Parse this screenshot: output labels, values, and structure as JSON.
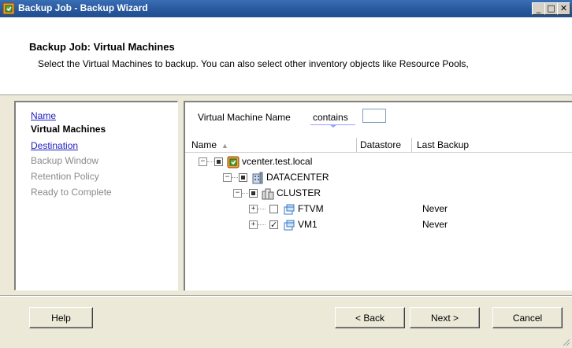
{
  "window": {
    "title": "Backup Job - Backup Wizard",
    "controls": {
      "minimize": "_",
      "maximize": "□",
      "close": "✕"
    }
  },
  "header": {
    "title": "Backup Job: Virtual Machines",
    "description": "Select the Virtual Machines to backup. You can also select other inventory objects like Resource Pools,"
  },
  "steps": [
    {
      "label": "Name",
      "state": "link"
    },
    {
      "label": "Virtual Machines",
      "state": "current"
    },
    {
      "label": "Destination",
      "state": "link"
    },
    {
      "label": "Backup Window",
      "state": "disabled"
    },
    {
      "label": "Retention Policy",
      "state": "disabled"
    },
    {
      "label": "Ready to Complete",
      "state": "disabled"
    }
  ],
  "filter": {
    "label": "Virtual Machine Name",
    "operator": "contains",
    "value": ""
  },
  "columns": {
    "name": "Name",
    "sort_indicator": "▲",
    "datastore": "Datastore",
    "last_backup": "Last Backup"
  },
  "tree": [
    {
      "label": "vcenter.test.local",
      "icon": "vcenter-icon",
      "check": "partial",
      "expander": "−",
      "last_backup": ""
    },
    {
      "label": "DATACENTER",
      "icon": "datacenter-icon",
      "check": "partial",
      "expander": "−",
      "last_backup": ""
    },
    {
      "label": "CLUSTER",
      "icon": "cluster-icon",
      "check": "partial",
      "expander": "−",
      "last_backup": ""
    },
    {
      "label": "FTVM",
      "icon": "vm-icon",
      "check": "unchecked",
      "expander": "+",
      "last_backup": "Never"
    },
    {
      "label": "VM1",
      "icon": "vm-icon",
      "check": "checked",
      "expander": "+",
      "last_backup": "Never"
    }
  ],
  "buttons": {
    "help": "Help",
    "back": "< Back",
    "next": "Next >",
    "cancel": "Cancel"
  },
  "colors": {
    "title_bar": "#2a5aa0",
    "link": "#2020c0",
    "disabled_text": "#8a8a8a",
    "dialog_bg": "#ece9d8"
  }
}
